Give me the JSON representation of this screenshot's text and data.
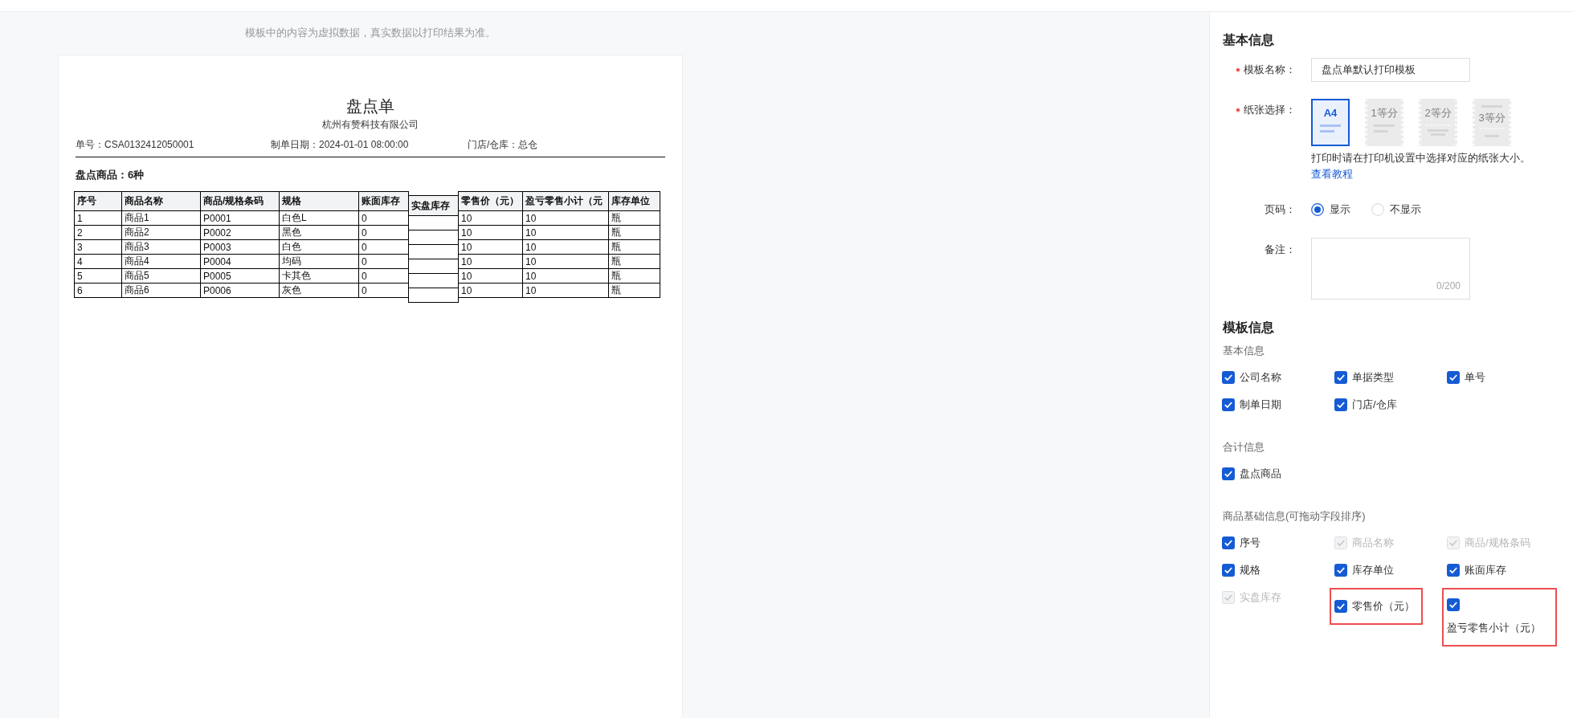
{
  "notice": "模板中的内容为虚拟数据，真实数据以打印结果为准。",
  "document": {
    "title": "盘点单",
    "company": "杭州有赞科技有限公司",
    "info": [
      "单号：CSA0132412050001",
      "制单日期：2024-01-01 08:00:00",
      "门店/仓库：总仓"
    ],
    "summary": "盘点商品：6种",
    "table": {
      "columns": [
        {
          "header": "序号",
          "kind": "data"
        },
        {
          "header": "商品名称",
          "kind": "data"
        },
        {
          "header": "商品/规格条码",
          "kind": "data"
        },
        {
          "header": "规格",
          "kind": "data"
        },
        {
          "header": "账面库存",
          "kind": "data"
        },
        {
          "header": "实盘库存",
          "kind": "blank"
        },
        {
          "header": "零售价（元）",
          "kind": "data"
        },
        {
          "header": "盈亏零售小计（元",
          "kind": "data"
        },
        {
          "header": "库存单位",
          "kind": "data"
        }
      ],
      "rows": [
        {
          "cells": [
            "1",
            "商品1",
            "P0001",
            "白色L",
            "0",
            "",
            "10",
            "10",
            "瓶"
          ]
        },
        {
          "cells": [
            "2",
            "商品2",
            "P0002",
            "黑色",
            "0",
            "",
            "10",
            "10",
            "瓶"
          ]
        },
        {
          "cells": [
            "3",
            "商品3",
            "P0003",
            "白色",
            "0",
            "",
            "10",
            "10",
            "瓶"
          ]
        },
        {
          "cells": [
            "4",
            "商品4",
            "P0004",
            "均码",
            "0",
            "",
            "10",
            "10",
            "瓶"
          ]
        },
        {
          "cells": [
            "5",
            "商品5",
            "P0005",
            "卡其色",
            "0",
            "",
            "10",
            "10",
            "瓶"
          ]
        },
        {
          "cells": [
            "6",
            "商品6",
            "P0006",
            "灰色",
            "0",
            "",
            "10",
            "10",
            "瓶"
          ]
        }
      ]
    }
  },
  "settings": {
    "basic": {
      "title": "基本信息",
      "name_field": {
        "label": "模板名称：",
        "required": true,
        "value": "盘点单默认打印模板"
      },
      "paper": {
        "label": "纸张选择：",
        "required": true,
        "options": [
          {
            "label": "A4",
            "kind": "a4",
            "selected": true
          },
          {
            "label": "1等分",
            "kind": "split1",
            "selected": false
          },
          {
            "label": "2等分",
            "kind": "split2",
            "selected": false
          },
          {
            "label": "3等分",
            "kind": "split3",
            "selected": false
          }
        ],
        "hint": "打印时请在打印机设置中选择对应的纸张大小。",
        "link": "查看教程"
      },
      "page_number": {
        "label": "页码：",
        "options": [
          {
            "label": "显示",
            "selected": true
          },
          {
            "label": "不显示",
            "selected": false
          }
        ]
      },
      "remark": {
        "label": "备注：",
        "counter": "0/200"
      }
    },
    "template_info": {
      "title": "模板信息",
      "groups": [
        {
          "title": "基本信息",
          "fields": [
            {
              "label": "公司名称",
              "checked": true,
              "disabled": false,
              "highlighted": false
            },
            {
              "label": "单据类型",
              "checked": true,
              "disabled": false,
              "highlighted": false
            },
            {
              "label": "单号",
              "checked": true,
              "disabled": false,
              "highlighted": false
            },
            {
              "label": "制单日期",
              "checked": true,
              "disabled": false,
              "highlighted": false
            },
            {
              "label": "门店/仓库",
              "checked": true,
              "disabled": false,
              "highlighted": false
            }
          ]
        },
        {
          "title": "合计信息",
          "fields": [
            {
              "label": "盘点商品",
              "checked": true,
              "disabled": false,
              "highlighted": false
            }
          ]
        },
        {
          "title": "商品基础信息(可拖动字段排序)",
          "fields": [
            {
              "label": "序号",
              "checked": true,
              "disabled": false,
              "highlighted": false
            },
            {
              "label": "商品名称",
              "checked": true,
              "disabled": true,
              "highlighted": false
            },
            {
              "label": "商品/规格条码",
              "checked": true,
              "disabled": true,
              "highlighted": false
            },
            {
              "label": "规格",
              "checked": true,
              "disabled": false,
              "highlighted": false
            },
            {
              "label": "库存单位",
              "checked": true,
              "disabled": false,
              "highlighted": false
            },
            {
              "label": "账面库存",
              "checked": true,
              "disabled": false,
              "highlighted": false
            },
            {
              "label": "实盘库存",
              "checked": true,
              "disabled": true,
              "highlighted": false
            },
            {
              "label": "零售价（元）",
              "checked": true,
              "disabled": false,
              "highlighted": true
            },
            {
              "label": "盈亏零售小计（元）",
              "checked": true,
              "disabled": false,
              "highlighted": true
            }
          ]
        }
      ]
    }
  }
}
